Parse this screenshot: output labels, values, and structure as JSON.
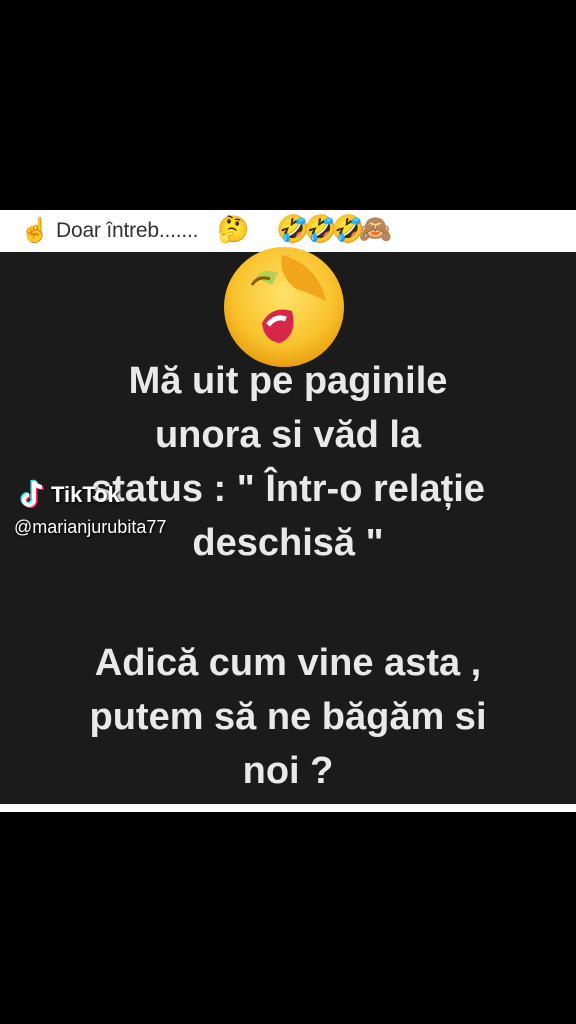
{
  "header": {
    "finger_emoji": "☝️",
    "text": "Doar întreb.......",
    "thinking_emoji": "🤔",
    "reaction_emojis": "🤣🤣🤣🙈"
  },
  "post": {
    "lines": [
      "Mă  uit pe paginile",
      "unora si văd la",
      "status  : \" Într-o relație",
      "deschisă \"",
      "Adică cum vine asta ,",
      "putem să ne băgăm si",
      "noi ?"
    ]
  },
  "watermark": {
    "brand": "TikTok",
    "username": "@marianjurubita77"
  },
  "colors": {
    "background": "#000000",
    "card": "#1b1b1b",
    "text": "#e9e9e9",
    "tiktok_cyan": "#25f4ee",
    "tiktok_red": "#fe2c55"
  }
}
